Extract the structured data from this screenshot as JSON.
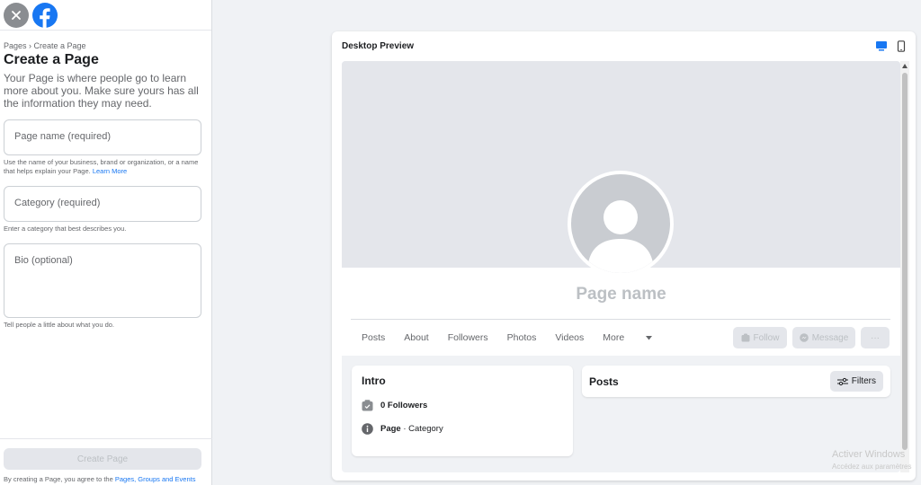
{
  "left": {
    "breadcrumb": "Pages › Create a Page",
    "title": "Create a Page",
    "subtitle": "Your Page is where people go to learn more about you. Make sure yours has all the information they may need.",
    "fields": {
      "page_name": {
        "placeholder": "Page name (required)",
        "help": "Use the name of your business, brand or organization, or a name that helps explain your Page.",
        "help_link": "Learn More"
      },
      "category": {
        "placeholder": "Category (required)",
        "help": "Enter a category that best describes you."
      },
      "bio": {
        "placeholder": "Bio (optional)",
        "help": "Tell people a little about what you do."
      }
    },
    "create_button": "Create Page",
    "terms_prefix": "By creating a Page, you agree to the",
    "terms_link": "Pages, Groups and Events"
  },
  "preview": {
    "title": "Desktop Preview",
    "page_name": "Page name",
    "tabs": [
      "Posts",
      "About",
      "Followers",
      "Photos",
      "Videos"
    ],
    "more_label": "More",
    "follow_label": "Follow",
    "message_label": "Message",
    "ellipsis_label": "···",
    "intro": {
      "title": "Intro",
      "followers": "0 Followers",
      "page_label": "Page",
      "category_label": "· Category"
    },
    "posts": {
      "title": "Posts",
      "filters_label": "Filters"
    }
  },
  "watermark": {
    "line1": "Activer Windows",
    "line2": "Accédez aux paramètres"
  },
  "colors": {
    "accent": "#1877f2",
    "disabled": "#bcc0c4",
    "background": "#f0f2f5"
  }
}
